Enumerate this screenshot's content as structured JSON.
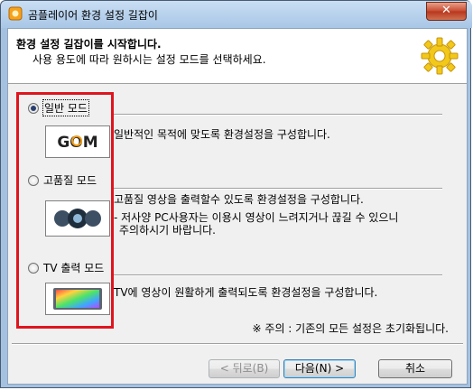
{
  "window": {
    "title": "곰플레이어 환경 설정 길잡이",
    "close_label": "✕"
  },
  "header": {
    "title": "환경 설정 길잡이를 시작합니다.",
    "subtitle": "사용 용도에 따라 원하시는 설정 모드를 선택하세요."
  },
  "modes": [
    {
      "label": "일반 모드",
      "selected": true,
      "thumb_text": "GOM",
      "description": [
        "일반적인 목적에 맞도록 환경설정을 구성합니다."
      ]
    },
    {
      "label": "고품질 모드",
      "selected": false,
      "description": [
        "고품질 영상을 출력할수 있도록 환경설정을 구성합니다.",
        "- 저사양 PC사용자는 이용시 영상이 느려지거나 끊길 수 있으니",
        "주의하시기 바랍니다."
      ]
    },
    {
      "label": "TV 출력 모드",
      "selected": false,
      "description": [
        "TV에 영상이 원활하게 출력되도록 환경설정을 구성합니다."
      ]
    }
  ],
  "note": "※ 주의 : 기존의 모든 설정은 초기화됩니다.",
  "buttons": {
    "back": "< 뒤로(B)",
    "next": "다음(N) >",
    "cancel": "취소"
  },
  "colors": {
    "highlight_box": "#e0141e",
    "titlebar": "#a8c6e6"
  }
}
